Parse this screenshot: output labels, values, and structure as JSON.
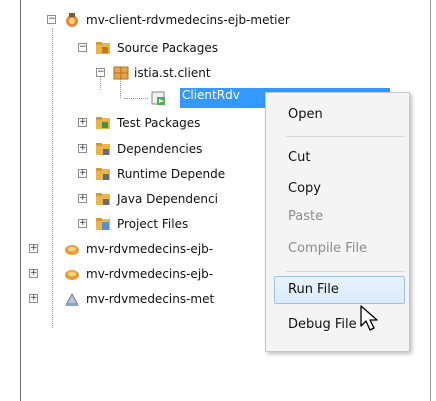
{
  "tree": {
    "items": [
      {
        "label": "mv-client-rdvmedecins-ejb-metier",
        "icon": "project-icon"
      },
      {
        "label": "Source Packages",
        "icon": "source-packages-icon"
      },
      {
        "label": "istia.st.client",
        "icon": "package-icon"
      },
      {
        "label": "ClientRdv",
        "icon": "java-class-icon"
      },
      {
        "label": "Test Packages",
        "icon": "test-packages-icon"
      },
      {
        "label": "Dependencies",
        "icon": "dependencies-icon"
      },
      {
        "label": "Runtime Depende",
        "icon": "runtime-dependencies-icon"
      },
      {
        "label": "Java Dependenci",
        "icon": "java-dependencies-icon"
      },
      {
        "label": "Project Files",
        "icon": "project-files-icon"
      },
      {
        "label": "mv-rdvmedecins-ejb-",
        "icon": "maven-project-icon"
      },
      {
        "label": "mv-rdvmedecins-ejb-",
        "icon": "maven-project-icon"
      },
      {
        "label": "mv-rdvmedecins-met",
        "icon": "maven-project-icon"
      }
    ]
  },
  "context_menu": {
    "items": [
      {
        "label": "Open",
        "enabled": true
      },
      {
        "label": "Cut",
        "enabled": true
      },
      {
        "label": "Copy",
        "enabled": true
      },
      {
        "label": "Paste",
        "enabled": false
      },
      {
        "label": "Compile File",
        "enabled": false
      },
      {
        "label": "Run File",
        "enabled": true,
        "highlighted": true
      },
      {
        "label": "Debug File",
        "enabled": true
      }
    ]
  },
  "colors": {
    "selection": "#3399ff",
    "menu_background": "#f4f4f4",
    "menu_highlight": "#dbeafb",
    "disabled_text": "#8d8d8d"
  }
}
